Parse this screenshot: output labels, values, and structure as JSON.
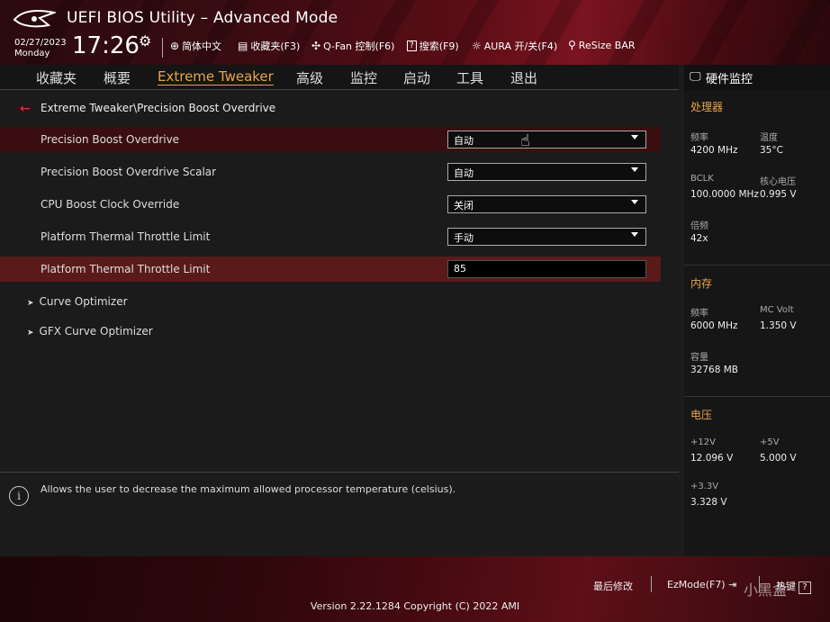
{
  "header": {
    "title": "UEFI BIOS Utility – Advanced Mode",
    "date": "02/27/2023",
    "weekday": "Monday",
    "time": "17:26",
    "tools": [
      {
        "icon": "globe-icon",
        "label": "简体中文"
      },
      {
        "icon": "bookmark-icon",
        "label": "收藏夹(F3)"
      },
      {
        "icon": "fan-icon",
        "label": "Q-Fan 控制(F6)"
      },
      {
        "icon": "question-icon",
        "label": "搜索(F9)"
      },
      {
        "icon": "aura-icon",
        "label": "AURA 开/关(F4)"
      },
      {
        "icon": "resize-bar-icon",
        "label": "ReSize BAR"
      }
    ]
  },
  "menu": {
    "items": [
      "收藏夹",
      "概要",
      "Extreme Tweaker",
      "高级",
      "监控",
      "启动",
      "工具",
      "退出"
    ],
    "active": "Extreme Tweaker"
  },
  "breadcrumb": "Extreme Tweaker\\Precision Boost Overdrive",
  "settings": [
    {
      "label": "Precision Boost Overdrive",
      "value": "自动"
    },
    {
      "label": "Precision Boost Overdrive Scalar",
      "value": "自动"
    },
    {
      "label": "CPU Boost Clock Override",
      "value": "关闭"
    },
    {
      "label": "Platform Thermal Throttle Limit",
      "value": "手动"
    },
    {
      "label": "Platform Thermal Throttle Limit",
      "value": "85"
    }
  ],
  "submenus": [
    "Curve Optimizer",
    "GFX Curve Optimizer"
  ],
  "help_text": "Allows the user to decrease the maximum allowed processor temperature (celsius).",
  "hw_monitor": {
    "title": "硬件监控",
    "cpu": {
      "section": "处理器",
      "freq_label": "频率",
      "freq": "4200 MHz",
      "temp_label": "温度",
      "temp": "35°C",
      "bclk_label": "BCLK",
      "bclk": "100.0000 MHz",
      "vcore_label": "核心电压",
      "vcore": "0.995 V",
      "ratio_label": "倍频",
      "ratio": "42x"
    },
    "memory": {
      "section": "内存",
      "freq_label": "频率",
      "freq": "6000 MHz",
      "volt_label": "MC Volt",
      "volt": "1.350 V",
      "cap_label": "容量",
      "cap": "32768 MB"
    },
    "voltage": {
      "section": "电压",
      "v12_label": "+12V",
      "v12": "12.096 V",
      "v5_label": "+5V",
      "v5": "5.000 V",
      "v33_label": "+3.3V",
      "v33": "3.328 V"
    }
  },
  "footer": {
    "last_modified": "最后修改",
    "ezmode": "EzMode(F7)",
    "hotkeys": "热键",
    "hotkeys_key": "?",
    "version": "Version 2.22.1284 Copyright (C) 2022 AMI",
    "watermark": "小黑盒"
  }
}
